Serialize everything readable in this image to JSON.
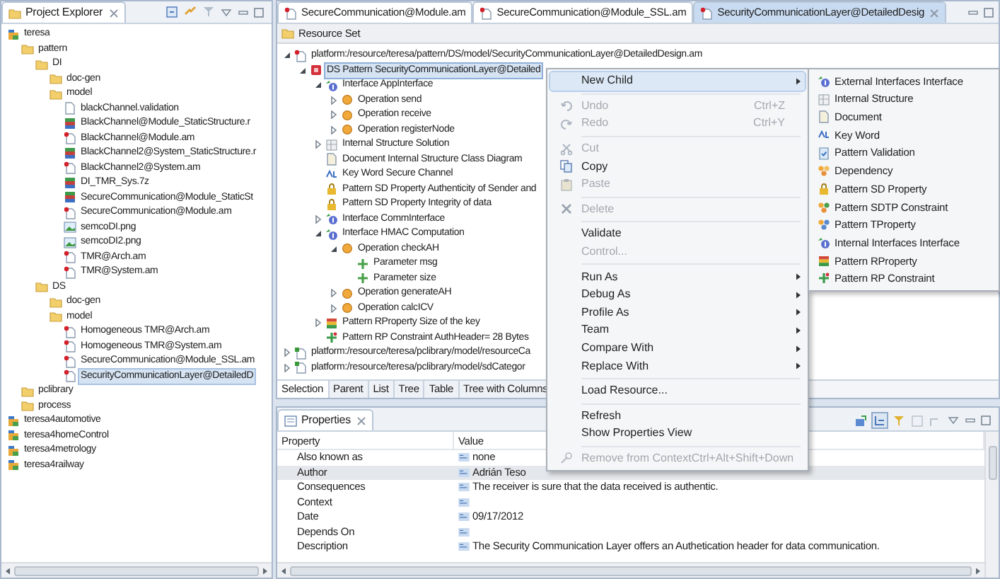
{
  "project_explorer": {
    "title": "Project Explorer",
    "tree": [
      {
        "label": "teresa",
        "kind": "project",
        "selected": false,
        "children": [
          {
            "label": "pattern",
            "kind": "folder",
            "selected": false,
            "children": [
              {
                "label": "DI",
                "kind": "folder",
                "selected": false,
                "children": [
                  {
                    "label": "doc-gen",
                    "kind": "folder",
                    "selected": false
                  },
                  {
                    "label": "model",
                    "kind": "folder",
                    "selected": false,
                    "children": [
                      {
                        "label": "blackChannel.validation",
                        "kind": "text",
                        "selected": false
                      },
                      {
                        "label": "BlackChannel@Module_StaticStructure.r",
                        "kind": "archive",
                        "selected": false
                      },
                      {
                        "label": "BlackChannel@Module.am",
                        "kind": "model",
                        "selected": false
                      },
                      {
                        "label": "BlackChannel2@System_StaticStructure.r",
                        "kind": "archive",
                        "selected": false
                      },
                      {
                        "label": "BlackChannel2@System.am",
                        "kind": "model",
                        "selected": false
                      },
                      {
                        "label": "DI_TMR_Sys.7z",
                        "kind": "archive",
                        "selected": false
                      },
                      {
                        "label": "SecureCommunication@Module_StaticSt",
                        "kind": "archive",
                        "selected": false
                      },
                      {
                        "label": "SecureCommunication@Module.am",
                        "kind": "model",
                        "selected": false
                      },
                      {
                        "label": "semcoDI.png",
                        "kind": "image",
                        "selected": false
                      },
                      {
                        "label": "semcoDI2.png",
                        "kind": "image",
                        "selected": false
                      },
                      {
                        "label": "TMR@Arch.am",
                        "kind": "model",
                        "selected": false
                      },
                      {
                        "label": "TMR@System.am",
                        "kind": "model",
                        "selected": false
                      }
                    ]
                  }
                ]
              },
              {
                "label": "DS",
                "kind": "folder",
                "selected": false,
                "children": [
                  {
                    "label": "doc-gen",
                    "kind": "folder",
                    "selected": false
                  },
                  {
                    "label": "model",
                    "kind": "folder",
                    "selected": false,
                    "children": [
                      {
                        "label": "Homogeneous TMR@Arch.am",
                        "kind": "model",
                        "selected": false
                      },
                      {
                        "label": "Homogeneous TMR@System.am",
                        "kind": "model",
                        "selected": false
                      },
                      {
                        "label": "SecureCommunication@Module_SSL.am",
                        "kind": "model",
                        "selected": false
                      },
                      {
                        "label": "SecurityCommunicationLayer@DetailedD",
                        "kind": "model",
                        "selected": true
                      }
                    ]
                  }
                ]
              }
            ]
          },
          {
            "label": "pclibrary",
            "kind": "folder",
            "selected": false
          },
          {
            "label": "process",
            "kind": "folder",
            "selected": false
          }
        ]
      },
      {
        "label": "teresa4automotive",
        "kind": "project",
        "selected": false
      },
      {
        "label": "teresa4homeControl",
        "kind": "project",
        "selected": false
      },
      {
        "label": "teresa4metrology",
        "kind": "project",
        "selected": false
      },
      {
        "label": "teresa4railway",
        "kind": "project",
        "selected": false
      }
    ]
  },
  "editor": {
    "tabs": [
      {
        "label": "SecureCommunication@Module.am",
        "selected": false
      },
      {
        "label": "SecureCommunication@Module_SSL.am",
        "selected": false
      },
      {
        "label": "SecurityCommunicationLayer@DetailedDesig",
        "selected": true
      }
    ],
    "header": "Resource Set",
    "tree": [
      {
        "label": "platform:/resource/teresa/pattern/DS/model/SecurityCommunicationLayer@DetailedDesign.am",
        "kind": "model",
        "expanded": true,
        "selected": false,
        "children": [
          {
            "label": "DS Pattern SecurityCommunicationLayer@Detailed",
            "kind": "pattern",
            "expanded": true,
            "selected": true,
            "children": [
              {
                "label": "Interface AppInterface",
                "kind": "interface",
                "expanded": true,
                "selected": false,
                "children": [
                  {
                    "label": "Operation send",
                    "kind": "operation",
                    "expanded": false,
                    "selected": false
                  },
                  {
                    "label": "Operation receive",
                    "kind": "operation",
                    "expanded": false,
                    "selected": false
                  },
                  {
                    "label": "Operation registerNode",
                    "kind": "operation",
                    "expanded": false,
                    "selected": false
                  }
                ]
              },
              {
                "label": "Internal Structure Solution",
                "kind": "structure",
                "expanded": false,
                "selected": false
              },
              {
                "label": "Document Internal Structure Class Diagram",
                "kind": "document",
                "selected": false
              },
              {
                "label": "Key Word Secure Channel",
                "kind": "keyword",
                "selected": false
              },
              {
                "label": "Pattern SD Property Authenticity of Sender and",
                "kind": "sdproperty",
                "selected": false
              },
              {
                "label": "Pattern SD Property Integrity of data",
                "kind": "sdproperty",
                "selected": false
              },
              {
                "label": "Interface CommInterface",
                "kind": "interface",
                "expanded": false,
                "selected": false
              },
              {
                "label": "Interface HMAC Computation",
                "kind": "interface",
                "expanded": true,
                "selected": false,
                "children": [
                  {
                    "label": "Operation checkAH",
                    "kind": "operation",
                    "expanded": true,
                    "selected": false,
                    "children": [
                      {
                        "label": "Parameter msg",
                        "kind": "parameter",
                        "selected": false
                      },
                      {
                        "label": "Parameter size",
                        "kind": "parameter",
                        "selected": false
                      }
                    ]
                  },
                  {
                    "label": "Operation generateAH",
                    "kind": "operation",
                    "expanded": false,
                    "selected": false
                  },
                  {
                    "label": "Operation calcICV",
                    "kind": "operation",
                    "expanded": false,
                    "selected": false
                  }
                ]
              },
              {
                "label": "Pattern RProperty Size of the key",
                "kind": "rproperty",
                "expanded": false,
                "selected": false
              },
              {
                "label": "Pattern RP Constraint AuthHeader= 28 Bytes",
                "kind": "rpconstraint",
                "selected": false
              }
            ]
          }
        ]
      },
      {
        "label": "platform:/resource/teresa/pclibrary/model/resourceCa",
        "kind": "library",
        "expanded": false,
        "selected": false
      },
      {
        "label": "platform:/resource/teresa/pclibrary/model/sdCategor",
        "kind": "library",
        "expanded": false,
        "selected": false
      }
    ],
    "view_tabs": [
      {
        "label": "Selection",
        "selected": true
      },
      {
        "label": "Parent",
        "selected": false
      },
      {
        "label": "List",
        "selected": false
      },
      {
        "label": "Tree",
        "selected": false
      },
      {
        "label": "Table",
        "selected": false
      },
      {
        "label": "Tree with Columns",
        "selected": false
      }
    ]
  },
  "properties": {
    "title": "Properties",
    "columns": [
      "Property",
      "Value"
    ],
    "rows": [
      {
        "property": "Also known as",
        "value": "none",
        "selected": false
      },
      {
        "property": "Author",
        "value": "Adrián Teso",
        "selected": true
      },
      {
        "property": "Consequences",
        "value": "The receiver is sure that the data received is authentic.",
        "selected": false
      },
      {
        "property": "Context",
        "selected": false
      },
      {
        "property": "Date",
        "value": "09/17/2012",
        "selected": false
      },
      {
        "property": "Depends On",
        "selected": false
      },
      {
        "property": "Description",
        "value": "The Security Communication Layer offers an Authetication header for data communication.",
        "selected": false
      }
    ]
  },
  "context_menu": {
    "items": [
      {
        "kind": "plain",
        "label": "New Child",
        "submenu": true,
        "selected": true,
        "disabled": false
      },
      {
        "kind": "separator"
      },
      {
        "kind": "undo",
        "label": "Undo",
        "shortcut": "Ctrl+Z",
        "submenu": false,
        "selected": false,
        "disabled": true
      },
      {
        "kind": "redo",
        "label": "Redo",
        "shortcut": "Ctrl+Y",
        "submenu": false,
        "selected": false,
        "disabled": true
      },
      {
        "kind": "separator"
      },
      {
        "kind": "cut",
        "label": "Cut",
        "submenu": false,
        "selected": false,
        "disabled": true
      },
      {
        "kind": "copy",
        "label": "Copy",
        "submenu": false,
        "selected": false,
        "disabled": false
      },
      {
        "kind": "paste",
        "label": "Paste",
        "submenu": false,
        "selected": false,
        "disabled": true
      },
      {
        "kind": "separator"
      },
      {
        "kind": "delete",
        "label": "Delete",
        "submenu": false,
        "selected": false,
        "disabled": true
      },
      {
        "kind": "separator"
      },
      {
        "kind": "plain",
        "label": "Validate",
        "submenu": false,
        "selected": false,
        "disabled": false
      },
      {
        "kind": "plain",
        "label": "Control...",
        "submenu": false,
        "selected": false,
        "disabled": true
      },
      {
        "kind": "separator"
      },
      {
        "kind": "plain",
        "label": "Run As",
        "submenu": true,
        "selected": false,
        "disabled": false
      },
      {
        "kind": "plain",
        "label": "Debug As",
        "submenu": true,
        "selected": false,
        "disabled": false
      },
      {
        "kind": "plain",
        "label": "Profile As",
        "submenu": true,
        "selected": false,
        "disabled": false
      },
      {
        "kind": "plain",
        "label": "Team",
        "submenu": true,
        "selected": false,
        "disabled": false
      },
      {
        "kind": "plain",
        "label": "Compare With",
        "submenu": true,
        "selected": false,
        "disabled": false
      },
      {
        "kind": "plain",
        "label": "Replace With",
        "submenu": true,
        "selected": false,
        "disabled": false
      },
      {
        "kind": "separator"
      },
      {
        "kind": "plain",
        "label": "Load Resource...",
        "submenu": false,
        "selected": false,
        "disabled": false
      },
      {
        "kind": "separator"
      },
      {
        "kind": "plain",
        "label": "Refresh",
        "submenu": false,
        "selected": false,
        "disabled": false
      },
      {
        "kind": "plain",
        "label": "Show Properties View",
        "submenu": false,
        "selected": false,
        "disabled": false
      },
      {
        "kind": "separator"
      },
      {
        "kind": "remove",
        "label": "Remove from Context",
        "shortcut": "Ctrl+Alt+Shift+Down",
        "submenu": false,
        "selected": false,
        "disabled": true
      }
    ]
  },
  "submenu": {
    "items": [
      {
        "label": "External Interfaces Interface",
        "kind": "interface",
        "selected": false
      },
      {
        "label": "Internal Structure",
        "kind": "structure",
        "selected": false
      },
      {
        "label": "Document",
        "kind": "document",
        "selected": false
      },
      {
        "label": "Key Word",
        "kind": "keyword",
        "selected": false
      },
      {
        "label": "Pattern Validation",
        "kind": "validation",
        "selected": false
      },
      {
        "label": "Dependency",
        "kind": "dependency",
        "selected": false
      },
      {
        "label": "Pattern SD Property",
        "kind": "sdproperty",
        "selected": false
      },
      {
        "label": "Pattern SDTP Constraint",
        "kind": "sdtp",
        "selected": false
      },
      {
        "label": "Pattern TProperty",
        "kind": "tproperty",
        "selected": false
      },
      {
        "label": "Internal Interfaces Interface",
        "kind": "interface",
        "selected": false
      },
      {
        "label": "Pattern RProperty",
        "kind": "rproperty",
        "selected": false
      },
      {
        "label": "Pattern RP Constraint",
        "kind": "rpconstraint",
        "selected": false
      }
    ]
  }
}
